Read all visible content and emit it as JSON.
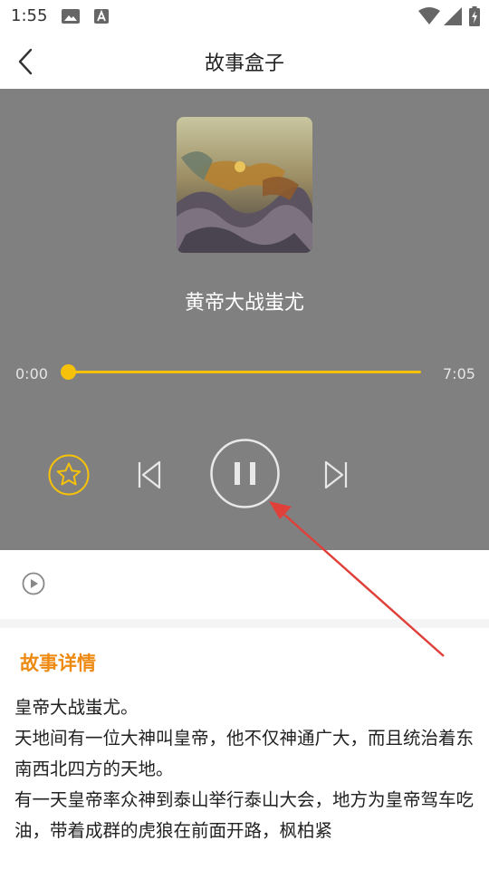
{
  "status_bar": {
    "time": "1:55",
    "icons": [
      "image-icon",
      "text-a-icon",
      "wifi-icon",
      "signal-icon",
      "battery-charging-icon"
    ]
  },
  "header": {
    "title": "故事盒子",
    "back_icon": "chevron-left-icon"
  },
  "player": {
    "background": "#808080",
    "accent": "#f5c10b",
    "story_title": "黄帝大战蚩尤",
    "elapsed": "0:00",
    "duration": "7:05",
    "progress": 0,
    "controls": [
      "favorite-star-icon",
      "previous-icon",
      "pause-icon",
      "next-icon"
    ]
  },
  "playlist_row": {
    "icon": "play-circle-icon"
  },
  "details": {
    "header": "故事详情",
    "header_color": "#ee8a12",
    "body": "皇帝大战蚩尤。\n天地间有一位大神叫皇帝，他不仅神通广大，而且统治着东南西北四方的天地。\n有一天皇帝率众神到泰山举行泰山大会，地方为皇帝驾车吃油，带着成群的虎狼在前面开路，枫柏紧"
  },
  "annotation": {
    "arrow_color": "#e0403a"
  }
}
